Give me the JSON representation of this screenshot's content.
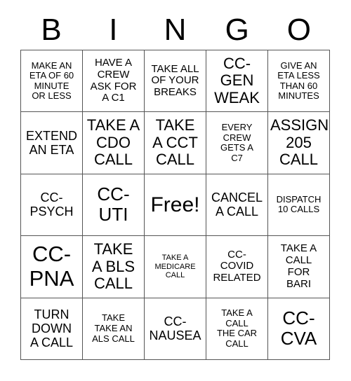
{
  "header": {
    "letters": [
      "B",
      "I",
      "N",
      "G",
      "O"
    ]
  },
  "grid": {
    "rows": 5,
    "columns": 5,
    "border_color": "#555555",
    "background_color": "#ffffff",
    "text_color": "#000000",
    "cells": [
      {
        "text": "MAKE AN\nETA OF 60\nMINUTE\nOR LESS",
        "size": "fs-sm"
      },
      {
        "text": "HAVE A\nCREW\nASK FOR\nA C1",
        "size": "fs-md"
      },
      {
        "text": "TAKE ALL\nOF YOUR\nBREAKS",
        "size": "fs-md"
      },
      {
        "text": "CC-\nGEN\nWEAK",
        "size": "fs-xl"
      },
      {
        "text": "GIVE AN\nETA LESS\nTHAN 60\nMINUTES",
        "size": "fs-sm"
      },
      {
        "text": "EXTEND\nAN ETA",
        "size": "fs-lg"
      },
      {
        "text": "TAKE A\nCDO\nCALL",
        "size": "fs-xl"
      },
      {
        "text": "TAKE\nA CCT\nCALL",
        "size": "fs-xl"
      },
      {
        "text": "EVERY\nCREW\nGETS A\nC7",
        "size": "fs-sm"
      },
      {
        "text": "ASSIGN\n205\nCALL",
        "size": "fs-xl"
      },
      {
        "text": "CC-\nPSYCH",
        "size": "fs-lg"
      },
      {
        "text": "CC-\nUTI",
        "size": "fs-xxl"
      },
      {
        "text": "Free!",
        "size": "fs-free"
      },
      {
        "text": "CANCEL\nA CALL",
        "size": "fs-lg"
      },
      {
        "text": "DISPATCH\n10 CALLS",
        "size": "fs-sm"
      },
      {
        "text": "CC-\nPNA",
        "size": "fs-huge"
      },
      {
        "text": "TAKE\nA BLS\nCALL",
        "size": "fs-xl"
      },
      {
        "text": "TAKE A\nMEDICARE\nCALL",
        "size": "fs-xs"
      },
      {
        "text": "CC-\nCOVID\nRELATED",
        "size": "fs-md"
      },
      {
        "text": "TAKE A\nCALL\nFOR\nBARI",
        "size": "fs-md"
      },
      {
        "text": "TURN\nDOWN\nA CALL",
        "size": "fs-lg"
      },
      {
        "text": "TAKE\nTAKE AN\nALS CALL",
        "size": "fs-sm"
      },
      {
        "text": "CC-\nNAUSEA",
        "size": "fs-lg"
      },
      {
        "text": "TAKE A\nCALL\nTHE CAR\nCALL",
        "size": "fs-sm"
      },
      {
        "text": "CC-\nCVA",
        "size": "fs-xxl"
      }
    ]
  }
}
